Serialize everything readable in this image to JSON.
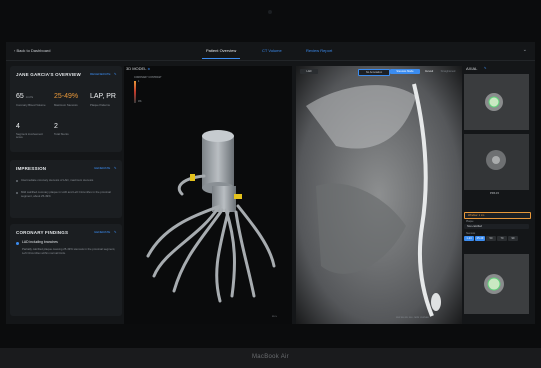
{
  "device": {
    "label": "MacBook Air"
  },
  "topbar": {
    "back_label": "Back to Dashboard",
    "tabs": [
      {
        "label": "Patient Overview",
        "active": true
      },
      {
        "label": "CT Volume",
        "active": false
      },
      {
        "label": "Review Report",
        "active": false
      }
    ]
  },
  "overview": {
    "title": "JANE GARCIA'S OVERVIEW",
    "action": "REGENERATE",
    "stats": [
      {
        "value": "65",
        "unit": "cm³/s",
        "label": "Coronary Blood Volume"
      },
      {
        "value": "25-49%",
        "label": "Maximum Stenosis"
      },
      {
        "value": "LAP, PR",
        "label": "Plaque Patterns"
      },
      {
        "value": "4",
        "label": "Segment involvement score"
      },
      {
        "value": "2",
        "label": "Total Stents"
      }
    ]
  },
  "impression": {
    "title": "IMPRESSION",
    "action": "GENERATE",
    "items": [
      "Intermediate coronary stenosis of LAD, maximum stenosis",
      "Mild calcified coronary plaque in LAD and Left Circumflex in the proximal segment, about 25-49%"
    ]
  },
  "findings": {
    "title": "CORONARY FINDINGS",
    "action": "GENERATE",
    "item_title": "LAD including branches",
    "item_text": "Partially calcified plaque causing 25-49% stenosis in the proximal segment, Left Circumflex within normal limits."
  },
  "model3d": {
    "title": "3D MODEL",
    "legend_title": "CORONARY CONTRAST",
    "legend_max": "1",
    "legend_min": "0%"
  },
  "ct": {
    "label": "LAD",
    "btn1": "No Annotation",
    "btn2": "Stenosis Mode",
    "toggle1": "Curved",
    "toggle2": "Straightened",
    "footer": "WW 800 WL 300 · MPR CURVED"
  },
  "axial": {
    "title": "AXIAL",
    "slice_label": "PDS 15",
    "window_label": "Window: 1 cm",
    "plaque_label": "Plaque",
    "plaque_value": "Non-calcified",
    "stenosis_label": "Stenosis",
    "chips": [
      "1-24",
      "25-49",
      "50",
      "70",
      "99"
    ]
  },
  "colors": {
    "accent": "#3b8cf0",
    "warning": "#e8983a",
    "stent": "#e4c21c"
  }
}
